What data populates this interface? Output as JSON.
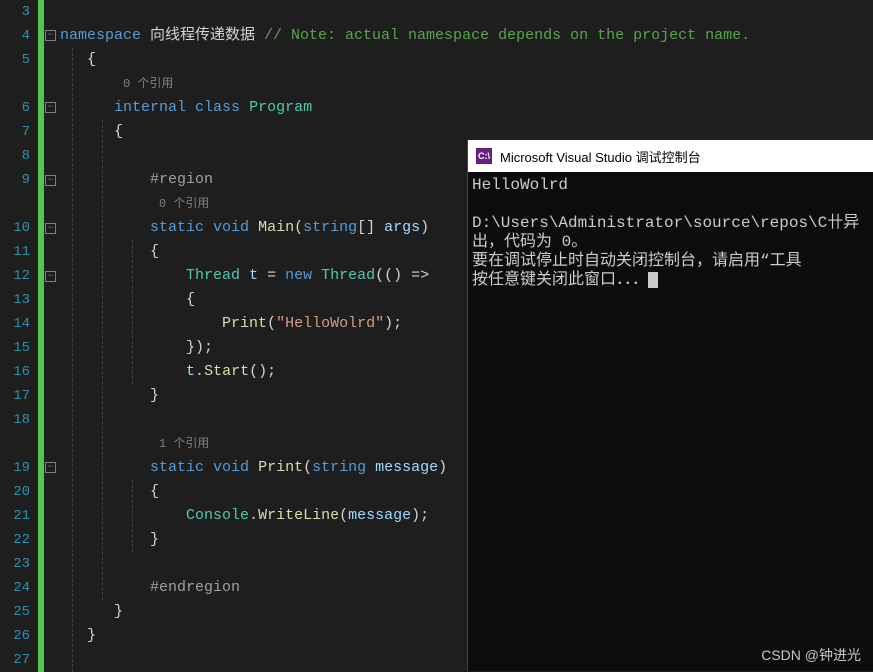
{
  "line_numbers": [
    "3",
    "4",
    "5",
    "",
    "6",
    "7",
    "8",
    "9",
    "",
    "10",
    "11",
    "12",
    "13",
    "14",
    "15",
    "16",
    "17",
    "18",
    "",
    "19",
    "20",
    "21",
    "22",
    "23",
    "24",
    "25",
    "26",
    "27"
  ],
  "refs": {
    "zero": "0 个引用",
    "one": "1 个引用"
  },
  "code": {
    "namespace_kw": "namespace",
    "namespace_name": " 向线程传递数据 ",
    "namespace_comment": "// Note: actual namespace depends on the project name.",
    "internal": "internal",
    "class": "class",
    "program": "Program",
    "region": "#region",
    "endregion": "#endregion",
    "static": "static",
    "void": "void",
    "main": "Main",
    "string_arr": "string",
    "args": "args",
    "thread_type": "Thread",
    "var_t": "t",
    "new_kw": "new",
    "lambda": "() =>",
    "print_call": "Print",
    "hello": "\"HelloWolrd\"",
    "start": "Start",
    "print_def": "Print",
    "string_type": "string",
    "message": "message",
    "console": "Console",
    "writeline": "WriteLine",
    "brace_open": "{",
    "brace_close": "}",
    "semi": ";",
    "paren_close_semi": ");",
    "bracket_pair": "[]"
  },
  "console": {
    "title": "Microsoft Visual Studio 调试控制台",
    "icon": "C:\\",
    "line1": "HelloWolrd",
    "line2": "",
    "line3": "D:\\Users\\Administrator\\source\\repos\\C卄异",
    "line4": "出，代码为 0。",
    "line5": "要在调试停止时自动关闭控制台，请启用“工具",
    "line6": "按任意键关闭此窗口．．．"
  },
  "watermark": "CSDN @钟进光"
}
